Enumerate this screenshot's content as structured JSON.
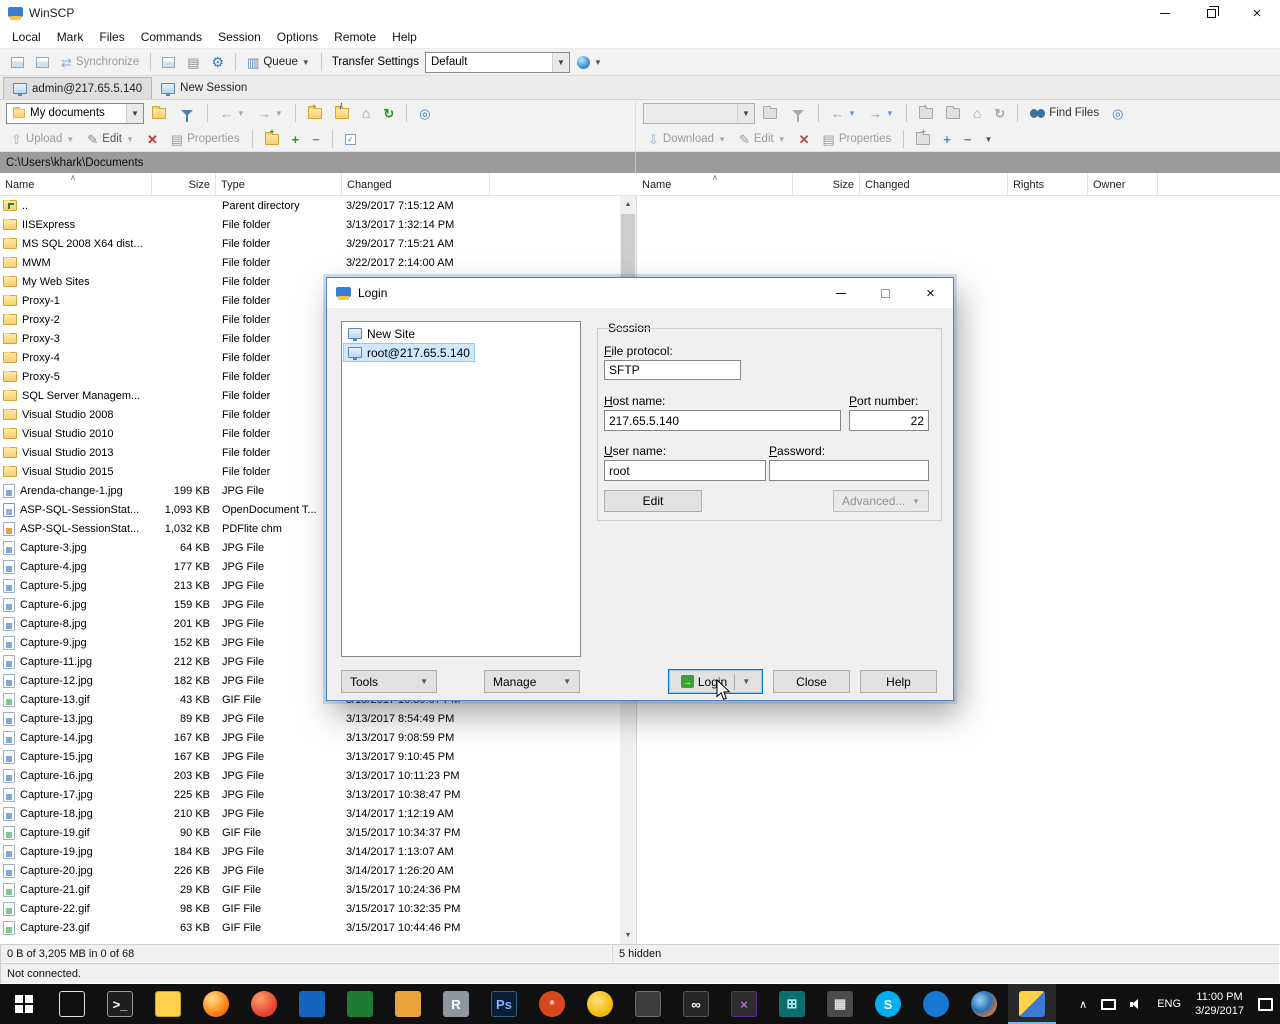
{
  "window": {
    "title": "WinSCP"
  },
  "menu": {
    "items": [
      "Local",
      "Mark",
      "Files",
      "Commands",
      "Session",
      "Options",
      "Remote",
      "Help"
    ]
  },
  "toolbar": {
    "synchronize_label": "Synchronize",
    "queue_label": "Queue",
    "transfer_settings_label": "Transfer Settings",
    "transfer_settings_value": "Default"
  },
  "session_tabs": {
    "active": "admin@217.65.5.140",
    "new_session": "New Session"
  },
  "left_panel": {
    "directory_combo": "My documents",
    "upload_label": "Upload",
    "edit_label": "Edit",
    "properties_label": "Properties",
    "path": "C:\\Users\\khark\\Documents",
    "columns": [
      "Name",
      "Size",
      "Type",
      "Changed"
    ],
    "rows": [
      {
        "icon": "parent",
        "name": "..",
        "size": "",
        "type": "Parent directory",
        "changed": "3/29/2017 7:15:12 AM"
      },
      {
        "icon": "folder",
        "name": "IISExpress",
        "size": "",
        "type": "File folder",
        "changed": "3/13/2017 1:32:14 PM"
      },
      {
        "icon": "folder",
        "name": "MS SQL 2008 X64 dist...",
        "size": "",
        "type": "File folder",
        "changed": "3/29/2017 7:15:21 AM"
      },
      {
        "icon": "folder",
        "name": "MWM",
        "size": "",
        "type": "File folder",
        "changed": "3/22/2017 2:14:00 AM"
      },
      {
        "icon": "folder",
        "name": "My Web Sites",
        "size": "",
        "type": "File folder",
        "changed": ""
      },
      {
        "icon": "folder",
        "name": "Proxy-1",
        "size": "",
        "type": "File folder",
        "changed": ""
      },
      {
        "icon": "folder",
        "name": "Proxy-2",
        "size": "",
        "type": "File folder",
        "changed": ""
      },
      {
        "icon": "folder",
        "name": "Proxy-3",
        "size": "",
        "type": "File folder",
        "changed": ""
      },
      {
        "icon": "folder",
        "name": "Proxy-4",
        "size": "",
        "type": "File folder",
        "changed": ""
      },
      {
        "icon": "folder",
        "name": "Proxy-5",
        "size": "",
        "type": "File folder",
        "changed": ""
      },
      {
        "icon": "folder",
        "name": "SQL Server Managem...",
        "size": "",
        "type": "File folder",
        "changed": ""
      },
      {
        "icon": "folder",
        "name": "Visual Studio 2008",
        "size": "",
        "type": "File folder",
        "changed": ""
      },
      {
        "icon": "folder",
        "name": "Visual Studio 2010",
        "size": "",
        "type": "File folder",
        "changed": ""
      },
      {
        "icon": "folder",
        "name": "Visual Studio 2013",
        "size": "",
        "type": "File folder",
        "changed": ""
      },
      {
        "icon": "folder",
        "name": "Visual Studio 2015",
        "size": "",
        "type": "File folder",
        "changed": ""
      },
      {
        "icon": "jpg",
        "name": "Arenda-change-1.jpg",
        "size": "199 KB",
        "type": "JPG File",
        "changed": ""
      },
      {
        "icon": "odt",
        "name": "ASP-SQL-SessionStat...",
        "size": "1,093 KB",
        "type": "OpenDocument T...",
        "changed": ""
      },
      {
        "icon": "chm",
        "name": "ASP-SQL-SessionStat...",
        "size": "1,032 KB",
        "type": "PDFlite chm",
        "changed": ""
      },
      {
        "icon": "jpg",
        "name": "Capture-3.jpg",
        "size": "64 KB",
        "type": "JPG File",
        "changed": ""
      },
      {
        "icon": "jpg",
        "name": "Capture-4.jpg",
        "size": "177 KB",
        "type": "JPG File",
        "changed": ""
      },
      {
        "icon": "jpg",
        "name": "Capture-5.jpg",
        "size": "213 KB",
        "type": "JPG File",
        "changed": ""
      },
      {
        "icon": "jpg",
        "name": "Capture-6.jpg",
        "size": "159 KB",
        "type": "JPG File",
        "changed": ""
      },
      {
        "icon": "jpg",
        "name": "Capture-8.jpg",
        "size": "201 KB",
        "type": "JPG File",
        "changed": ""
      },
      {
        "icon": "jpg",
        "name": "Capture-9.jpg",
        "size": "152 KB",
        "type": "JPG File",
        "changed": ""
      },
      {
        "icon": "jpg",
        "name": "Capture-11.jpg",
        "size": "212 KB",
        "type": "JPG File",
        "changed": ""
      },
      {
        "icon": "jpg",
        "name": "Capture-12.jpg",
        "size": "182 KB",
        "type": "JPG File",
        "changed": ""
      },
      {
        "icon": "gif",
        "name": "Capture-13.gif",
        "size": "43 KB",
        "type": "GIF File",
        "changed": "3/15/2017 10:39:07 PM"
      },
      {
        "icon": "jpg",
        "name": "Capture-13.jpg",
        "size": "89 KB",
        "type": "JPG File",
        "changed": "3/13/2017 8:54:49 PM"
      },
      {
        "icon": "jpg",
        "name": "Capture-14.jpg",
        "size": "167 KB",
        "type": "JPG File",
        "changed": "3/13/2017 9:08:59 PM"
      },
      {
        "icon": "jpg",
        "name": "Capture-15.jpg",
        "size": "167 KB",
        "type": "JPG File",
        "changed": "3/13/2017 9:10:45 PM"
      },
      {
        "icon": "jpg",
        "name": "Capture-16.jpg",
        "size": "203 KB",
        "type": "JPG File",
        "changed": "3/13/2017 10:11:23 PM"
      },
      {
        "icon": "jpg",
        "name": "Capture-17.jpg",
        "size": "225 KB",
        "type": "JPG File",
        "changed": "3/13/2017 10:38:47 PM"
      },
      {
        "icon": "jpg",
        "name": "Capture-18.jpg",
        "size": "210 KB",
        "type": "JPG File",
        "changed": "3/14/2017 1:12:19 AM"
      },
      {
        "icon": "gif",
        "name": "Capture-19.gif",
        "size": "90 KB",
        "type": "GIF File",
        "changed": "3/15/2017 10:34:37 PM"
      },
      {
        "icon": "jpg",
        "name": "Capture-19.jpg",
        "size": "184 KB",
        "type": "JPG File",
        "changed": "3/14/2017 1:13:07 AM"
      },
      {
        "icon": "jpg",
        "name": "Capture-20.jpg",
        "size": "226 KB",
        "type": "JPG File",
        "changed": "3/14/2017 1:26:20 AM"
      },
      {
        "icon": "gif",
        "name": "Capture-21.gif",
        "size": "29 KB",
        "type": "GIF File",
        "changed": "3/15/2017 10:24:36 PM"
      },
      {
        "icon": "gif",
        "name": "Capture-22.gif",
        "size": "98 KB",
        "type": "GIF File",
        "changed": "3/15/2017 10:32:35 PM"
      },
      {
        "icon": "gif",
        "name": "Capture-23.gif",
        "size": "63 KB",
        "type": "GIF File",
        "changed": "3/15/2017 10:44:46 PM"
      }
    ]
  },
  "right_panel": {
    "download_label": "Download",
    "edit_label": "Edit",
    "properties_label": "Properties",
    "find_files_label": "Find Files",
    "columns": [
      "Name",
      "Size",
      "Changed",
      "Rights",
      "Owner"
    ]
  },
  "status_bar": {
    "summary": "0 B of 3,205 MB in 0 of 68",
    "hidden": "5 hidden",
    "connection": "Not connected."
  },
  "login_dialog": {
    "title": "Login",
    "sites": [
      {
        "label": "New Site",
        "selected": false
      },
      {
        "label": "root@217.65.5.140",
        "selected": true
      }
    ],
    "group_label": "Session",
    "file_protocol_label": "File protocol:",
    "file_protocol_value": "SFTP",
    "host_name_label": "Host name:",
    "host_name_value": "217.65.5.140",
    "port_label": "Port number:",
    "port_value": "22",
    "user_name_label": "User name:",
    "user_name_value": "root",
    "password_label": "Password:",
    "password_value": "",
    "edit_button": "Edit",
    "advanced_button": "Advanced...",
    "tools_button": "Tools",
    "manage_button": "Manage",
    "login_button": "Login",
    "close_button": "Close",
    "help_button": "Help"
  },
  "taskbar": {
    "language": "ENG",
    "time": "11:00 PM",
    "date": "3/29/2017",
    "icons": [
      {
        "name": "task-view",
        "glyph": "",
        "bg": "transparent",
        "border": "#e0e0e0"
      },
      {
        "name": "command-prompt",
        "glyph": ">_",
        "bg": "#1f1f1f",
        "fg": "#ffffff",
        "border": "#9a9a9a"
      },
      {
        "name": "file-explorer",
        "glyph": "",
        "bg": "#ffd04a",
        "border": "#c9a227"
      },
      {
        "name": "firefox",
        "glyph": "",
        "bg": "radial-gradient(circle at 35% 30%, #ffe08a, #ff8a1e 55%, #d9480f)",
        "shape": "round"
      },
      {
        "name": "browser-red",
        "glyph": "",
        "bg": "radial-gradient(circle at 35% 30%, #ff9d6b, #e23f2e 70%)",
        "shape": "round"
      },
      {
        "name": "app-blue",
        "glyph": "",
        "bg": "#1565c0"
      },
      {
        "name": "app-green",
        "glyph": "",
        "bg": "#1e7b34"
      },
      {
        "name": "writer-app",
        "glyph": "",
        "bg": "#e8a33d"
      },
      {
        "name": "r-app",
        "glyph": "R",
        "bg": "#8f959d",
        "fg": "#ffffff"
      },
      {
        "name": "photoshop",
        "glyph": "Ps",
        "bg": "#0b1c33",
        "fg": "#7ab4ff",
        "border": "#2e5c8a"
      },
      {
        "name": "burst-app",
        "glyph": "*",
        "bg": "#d8481f",
        "fg": "#ffd9c4",
        "shape": "round"
      },
      {
        "name": "app-yellow",
        "glyph": "",
        "bg": "radial-gradient(circle at 40% 35%, #ffe27a, #f2b705 70%)",
        "shape": "round"
      },
      {
        "name": "tool-app",
        "glyph": "",
        "bg": "#3c3c3c",
        "border": "#6b6b6b"
      },
      {
        "name": "infinity-app",
        "glyph": "∞",
        "bg": "#262626",
        "fg": "#ffffff",
        "border": "#555555"
      },
      {
        "name": "purple-x-app",
        "glyph": "×",
        "bg": "#2d2d2d",
        "fg": "#b06ae0",
        "border": "#5c2d91"
      },
      {
        "name": "remote-desktop",
        "glyph": "⊞",
        "bg": "#0e6f6f",
        "fg": "#bfeaea"
      },
      {
        "name": "media-app",
        "glyph": "▦",
        "bg": "#4a4a4a",
        "fg": "#dddddd"
      },
      {
        "name": "skype",
        "glyph": "S",
        "bg": "#00aff0",
        "fg": "#ffffff",
        "shape": "round"
      },
      {
        "name": "app-blue-2",
        "glyph": "",
        "bg": "#1976d2",
        "shape": "round"
      },
      {
        "name": "browser-orange",
        "glyph": "",
        "bg": "radial-gradient(circle at 35% 35%, #9ad0f5, #2b6fb3 45%, #e87b1e 80%)",
        "shape": "round"
      },
      {
        "name": "winscp",
        "glyph": "",
        "bg": "linear-gradient(135deg,#ffd24a 50%,#3b7bd4 50%)",
        "active": true
      }
    ]
  }
}
